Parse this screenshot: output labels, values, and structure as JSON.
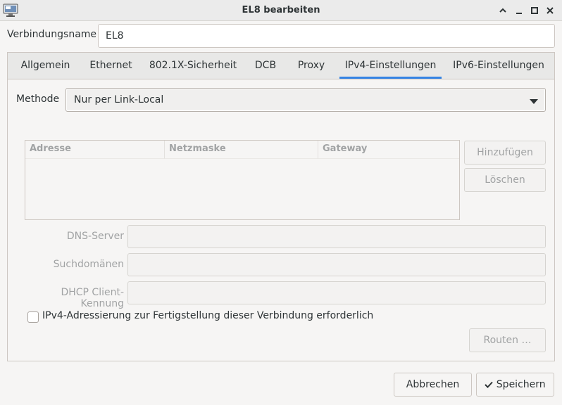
{
  "window": {
    "title": "EL8 bearbeiten",
    "icons": [
      "network-settings-icon",
      "maximize-up-icon",
      "minimize-icon",
      "restore-icon",
      "close-icon"
    ]
  },
  "connection": {
    "name_label": "Verbindungsname",
    "name_value": "EL8"
  },
  "tabs": [
    {
      "label": "Allgemein",
      "active": false
    },
    {
      "label": "Ethernet",
      "active": false
    },
    {
      "label": "802.1X-Sicherheit",
      "active": false
    },
    {
      "label": "DCB",
      "active": false
    },
    {
      "label": "Proxy",
      "active": false
    },
    {
      "label": "IPv4-Einstellungen",
      "active": true
    },
    {
      "label": "IPv6-Einstellungen",
      "active": false
    }
  ],
  "ipv4": {
    "method_label": "Methode",
    "method_value": "Nur per Link-Local",
    "table": {
      "columns": [
        "Adresse",
        "Netzmaske",
        "Gateway"
      ],
      "rows": []
    },
    "add_button": "Hinzufügen",
    "delete_button": "Löschen",
    "dns_label": "DNS-Server",
    "dns_value": "",
    "search_label": "Suchdomänen",
    "search_value": "",
    "dhcp_label": "DHCP Client-Kennung",
    "dhcp_value": "",
    "require_label": "IPv4-Adressierung zur Fertigstellung dieser Verbindung erforderlich",
    "require_checked": false,
    "routes_button": "Routen …"
  },
  "footer": {
    "cancel": "Abbrechen",
    "save": "Speichern"
  },
  "colors": {
    "accent": "#3584e4",
    "background": "#f6f5f4",
    "disabled_text": "#a1a3a4"
  }
}
